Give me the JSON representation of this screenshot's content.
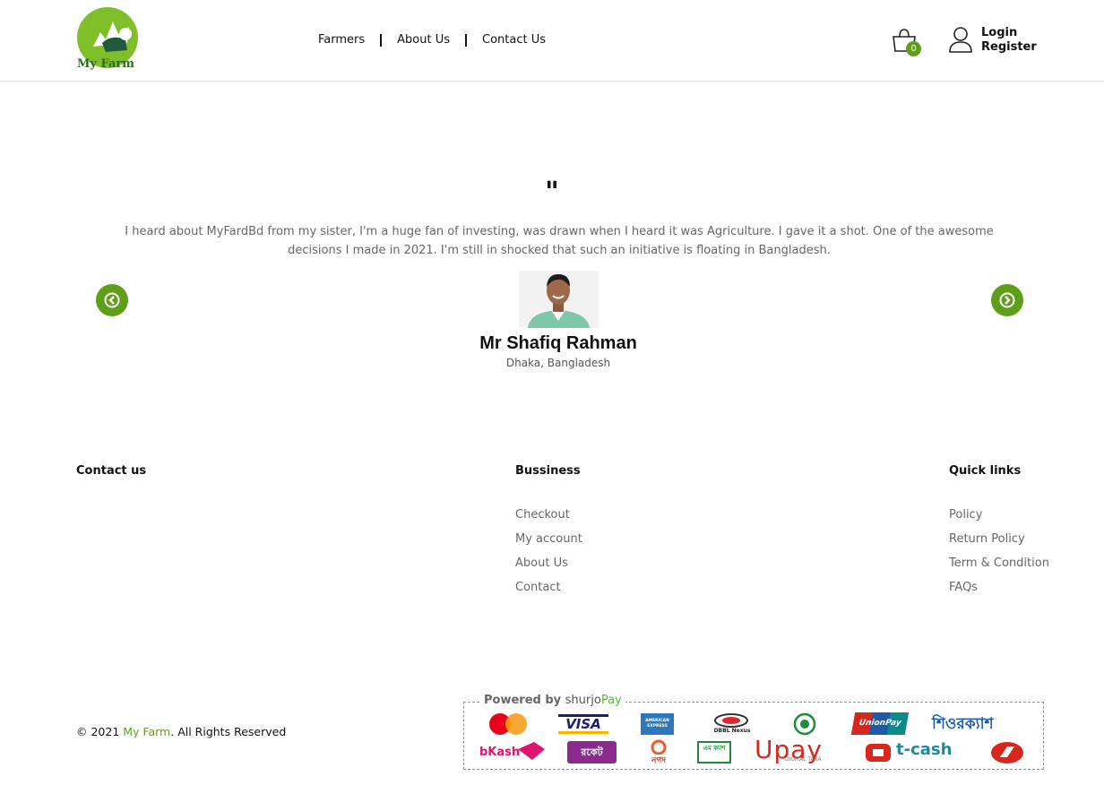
{
  "header": {
    "logo_text": "My Farm",
    "nav": [
      "Farmers",
      "About Us",
      "Contact Us"
    ],
    "cart_count": "0",
    "login": "Login",
    "register": "Register"
  },
  "testimonial": {
    "quote_mark": "\"",
    "text": "I heard about MyFardBd from my sister, I'm a huge fan of investing, was drawn when I heard it was Agriculture. I gave it a shot. One of the awesome decisions I made in 2021. I'm still in shocked that such an initiative is floating in Bangladesh.",
    "name": "Mr Shafiq Rahman",
    "location": "Dhaka, Bangladesh"
  },
  "footer": {
    "contact_heading": "Contact us",
    "business_heading": "Bussiness",
    "business_links": [
      "Checkout",
      "My account",
      "About Us",
      "Contact"
    ],
    "quick_heading": "Quick links",
    "quick_links": [
      "Policy",
      "Return Policy",
      "Term & Condition",
      "FAQs"
    ],
    "copyright_prefix": "© 2021",
    "copyright_brand": "My Farm",
    "copyright_suffix": ". All Rights Reserved"
  },
  "payment": {
    "powered_label": "Powered by",
    "brand_a": "shurjo",
    "brand_b": "Pay",
    "row1": [
      "VISA",
      "AMERICAN EXPRESS",
      "DBBL Nexus",
      "UnionPay",
      "শিওরক্যাশ"
    ],
    "row2": [
      "bKash",
      "রকেট",
      "নগদ",
      "এম ক্যাশ",
      "Upay",
      "DIGITAL TAKA",
      "t-cash"
    ]
  },
  "colors": {
    "accent": "#5e9e1a"
  }
}
